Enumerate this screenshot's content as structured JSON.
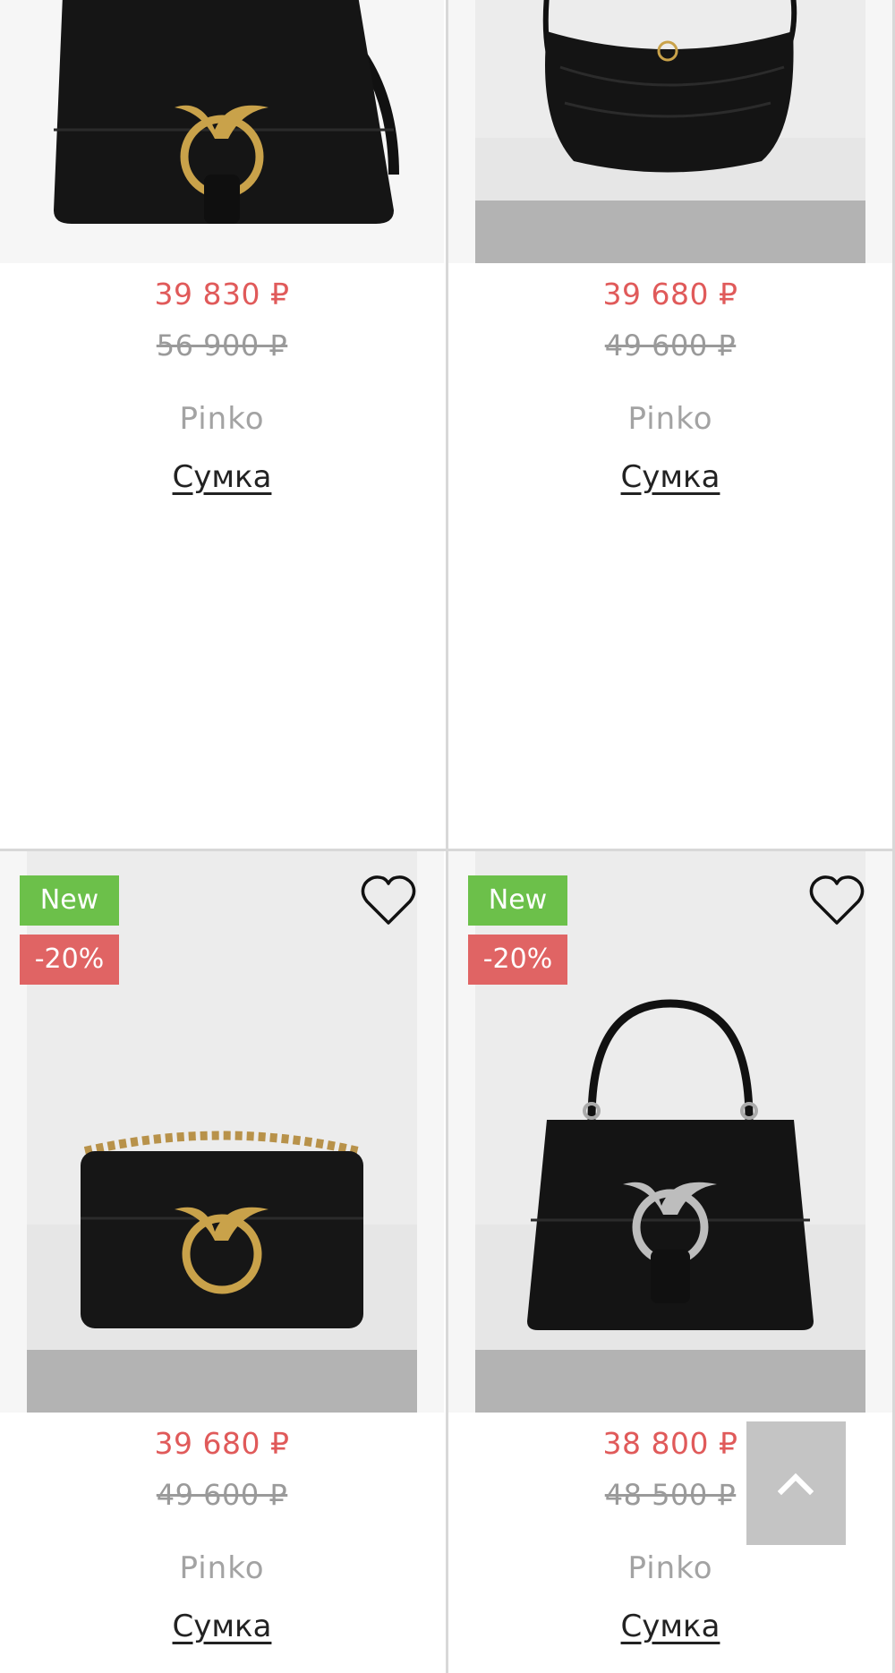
{
  "products": [
    {
      "price": "39 830 ₽",
      "old_price": "56 900 ₽",
      "brand": "Pinko",
      "name": "Сумка"
    },
    {
      "price": "39 680 ₽",
      "old_price": "49 600 ₽",
      "brand": "Pinko",
      "name": "Сумка"
    },
    {
      "badge_new": "New",
      "badge_discount": "-20%",
      "price": "39 680 ₽",
      "old_price": "49 600 ₽",
      "brand": "Pinko",
      "name": "Сумка"
    },
    {
      "badge_new": "New",
      "badge_discount": "-20%",
      "price": "38 800 ₽",
      "old_price": "48 500 ₽",
      "brand": "Pinko",
      "name": "Сумка"
    }
  ],
  "icons": {
    "favorite": "heart-outline-icon",
    "scroll_top": "chevron-up-icon"
  },
  "colors": {
    "price": "#e05a5a",
    "badge_new": "#6cc04a",
    "badge_discount": "#e06464"
  }
}
